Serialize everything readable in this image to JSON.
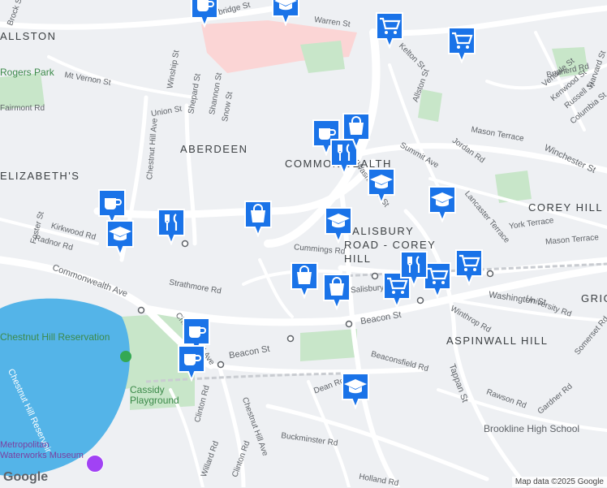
{
  "map": {
    "attribution": "Map data ©2025 Google",
    "logo": "Google",
    "colors": {
      "background": "#eef0f3",
      "road": "#ffffff",
      "water": "#54b4e8",
      "park": "#c8e6c9",
      "hospital": "#fbd5d5",
      "pin": "#1a73e8"
    },
    "areas": [
      "ABERDEEN",
      "COMMONWEALTH",
      "COREY HILL",
      "SALISBURY ROAD - COREY HILL",
      "ASPINWALL HILL",
      "ELIZABETH'S",
      "ALLSTON",
      "GRIGGS"
    ],
    "parks": [
      "Rogers Park",
      "Cassidy Playground"
    ],
    "landmarks": [
      "Chestnut Hill Reservation",
      "Chestnut Hill Reservoir",
      "Metropolitan Waterworks Museum",
      "Brookline High School"
    ],
    "streets": [
      "Cambridge St",
      "Warren St",
      "Kelton St",
      "Allston St",
      "Brainerd Rd",
      "Mt Vernon St",
      "Winship St",
      "Shepard St",
      "Shannon St",
      "Snow St",
      "Union St",
      "Chestnut Hill Ave",
      "Kirkwood Rd",
      "Radnor Rd",
      "Foster St",
      "Commonwealth Ave",
      "Strathmore Rd",
      "Cummings Rd",
      "Salisbury Rd",
      "Beacon St",
      "Washington St",
      "Summit Ave",
      "Mason Terrace",
      "Jordan Rd",
      "Winchester St",
      "Lancaster Terrace",
      "York Terrace",
      "Vendale St",
      "Kenwood St",
      "Russell St",
      "Columbia St",
      "Harvard St",
      "Winthrop Rd",
      "University Rd",
      "Beaconsfield Rd",
      "Tappan St",
      "Rawson Rd",
      "Gardner Rd",
      "Somerset Rd",
      "Dean Rd",
      "Buckminster Rd",
      "Clinton Rd",
      "Willard Rd",
      "Holland Rd",
      "Fairmont Rd",
      "Lake St",
      "Brock St",
      "Rd",
      "Ave",
      "Cl"
    ],
    "pois": [
      {
        "type": "cafe",
        "icon": "coffee-cup-icon"
      },
      {
        "type": "school",
        "icon": "graduation-cap-icon"
      },
      {
        "type": "grocery",
        "icon": "shopping-cart-icon"
      },
      {
        "type": "restaurant",
        "icon": "fork-knife-icon"
      },
      {
        "type": "shop",
        "icon": "shopping-bag-icon"
      }
    ]
  }
}
